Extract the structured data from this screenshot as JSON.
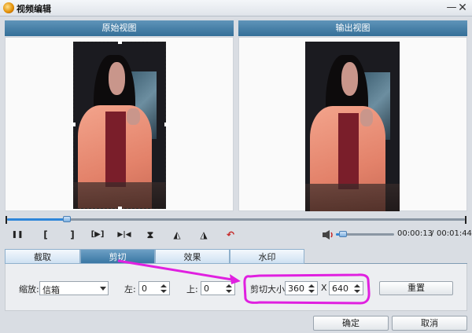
{
  "window": {
    "title": "视频编辑",
    "minimize_label": "—",
    "close_label": "✕",
    "app_icon": "app-icon"
  },
  "views": {
    "original_label": "原始视图",
    "output_label": "输出视图"
  },
  "playback": {
    "progress": 0.13,
    "volume": 0.05,
    "current_time": "00:00:13",
    "total_time": "00:01:44",
    "buttons": [
      {
        "name": "pause-button",
        "glyph": "❚❚"
      },
      {
        "name": "mark-in-button",
        "glyph": "["
      },
      {
        "name": "mark-out-button",
        "glyph": "]"
      },
      {
        "name": "play-selection-button",
        "glyph": "[▶]"
      },
      {
        "name": "play-between-button",
        "glyph": "▶|◀"
      },
      {
        "name": "flip-vertical-button",
        "glyph": "⧗"
      },
      {
        "name": "rotate-left-button",
        "glyph": "◭"
      },
      {
        "name": "rotate-right-button",
        "glyph": "◮"
      },
      {
        "name": "undo-button",
        "glyph": "↶"
      }
    ]
  },
  "tabs": [
    {
      "label": "截取",
      "active": false
    },
    {
      "label": "剪切",
      "active": true
    },
    {
      "label": "效果",
      "active": false
    },
    {
      "label": "水印",
      "active": false
    }
  ],
  "crop": {
    "zoom_label": "缩放:",
    "zoom_value": "信箱",
    "left_label": "左:",
    "left_value": "0",
    "top_label": "上:",
    "top_value": "0",
    "size_label": "剪切大小:",
    "width_value": "360",
    "x_label": "X",
    "height_value": "640",
    "reset_label": "重置"
  },
  "footer": {
    "ok_label": "确定",
    "cancel_label": "取消"
  },
  "colors": {
    "annotation": "#e020e0",
    "accent": "#2f86d9",
    "header": "#3a77a4"
  }
}
